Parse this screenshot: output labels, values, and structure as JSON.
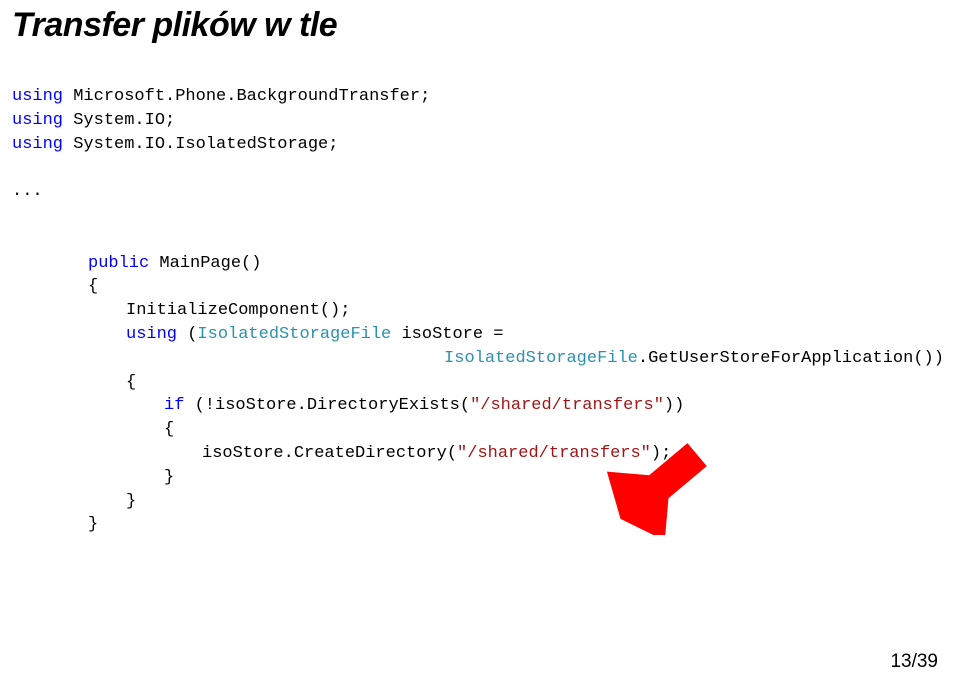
{
  "title": "Transfer plików w tle",
  "code": {
    "lines": [
      {
        "indent": 0,
        "spans": [
          {
            "txt": "using",
            "cls": "k-blue"
          },
          {
            "txt": " Microsoft.Phone.BackgroundTransfer;"
          }
        ]
      },
      {
        "indent": 0,
        "spans": [
          {
            "txt": "using",
            "cls": "k-blue"
          },
          {
            "txt": " System.IO;"
          }
        ]
      },
      {
        "indent": 0,
        "spans": [
          {
            "txt": "using",
            "cls": "k-blue"
          },
          {
            "txt": " System.IO.IsolatedStorage;"
          }
        ]
      },
      {
        "indent": 0,
        "spans": []
      },
      {
        "indent": 0,
        "spans": [
          {
            "txt": "...",
            "cls": ""
          }
        ]
      },
      {
        "indent": 0,
        "spans": []
      },
      {
        "indent": 0,
        "spans": []
      },
      {
        "indent": 1,
        "spans": [
          {
            "txt": "public",
            "cls": "k-blue"
          },
          {
            "txt": " MainPage()"
          }
        ]
      },
      {
        "indent": 1,
        "spans": [
          {
            "txt": "{"
          }
        ]
      },
      {
        "indent": 2,
        "spans": [
          {
            "txt": "InitializeComponent();"
          }
        ]
      },
      {
        "indent": 2,
        "spans": [
          {
            "txt": "using",
            "cls": "k-blue"
          },
          {
            "txt": " ("
          },
          {
            "txt": "IsolatedStorageFile",
            "cls": "k-teal"
          },
          {
            "txt": " isoStore = "
          }
        ]
      },
      {
        "indent": 5,
        "spans": [
          {
            "txt": "                    "
          },
          {
            "txt": "IsolatedStorageFile",
            "cls": "k-teal"
          },
          {
            "txt": ".GetUserStoreForApplication())"
          }
        ]
      },
      {
        "indent": 2,
        "spans": [
          {
            "txt": "{"
          }
        ]
      },
      {
        "indent": 3,
        "spans": [
          {
            "txt": "if",
            "cls": "k-blue"
          },
          {
            "txt": " (!isoStore.DirectoryExists("
          },
          {
            "txt": "\"/shared/transfers\"",
            "cls": "k-red"
          },
          {
            "txt": "))"
          }
        ]
      },
      {
        "indent": 3,
        "spans": [
          {
            "txt": "{"
          }
        ]
      },
      {
        "indent": 4,
        "spans": [
          {
            "txt": "isoStore.CreateDirectory("
          },
          {
            "txt": "\"/shared/transfers\"",
            "cls": "k-red"
          },
          {
            "txt": ");"
          }
        ]
      },
      {
        "indent": 3,
        "spans": [
          {
            "txt": "}"
          }
        ]
      },
      {
        "indent": 2,
        "spans": [
          {
            "txt": "}"
          }
        ]
      },
      {
        "indent": 1,
        "spans": [
          {
            "txt": "}"
          }
        ]
      }
    ]
  },
  "page": {
    "current": 13,
    "total": 39,
    "display": "13/39"
  },
  "arrow": {
    "color": "#ff0000"
  }
}
